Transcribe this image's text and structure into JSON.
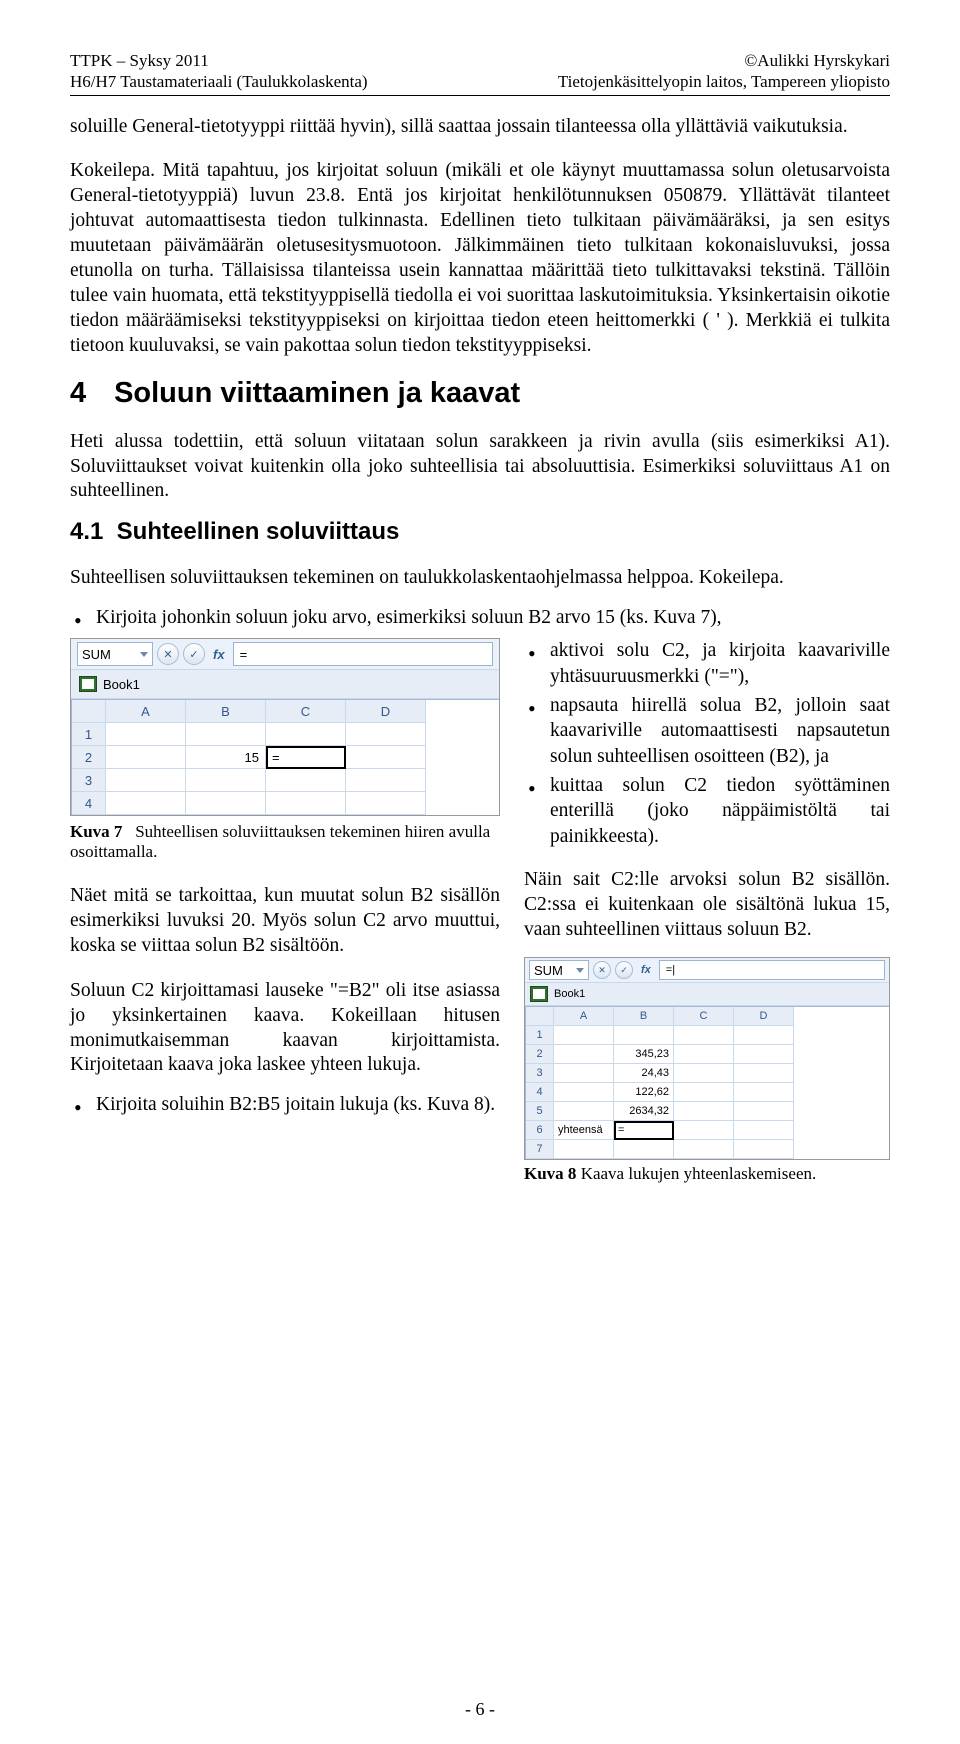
{
  "header": {
    "leftTop": "TTPK – Syksy 2011",
    "leftBottom": "H6/H7 Taustamateriaali (Taulukkolaskenta)",
    "rightTop": "©Aulikki Hyrskykari",
    "rightBottom": "Tietojenkäsittelyopin laitos, Tampereen yliopisto"
  },
  "para1": "soluille General-tietotyyppi riittää hyvin), sillä saattaa jossain tilanteessa olla yllättäviä vaikutuksia.",
  "para2": "Kokeilepa. Mitä tapahtuu, jos kirjoitat soluun (mikäli et ole käynyt muuttamassa solun oletusarvoista General-tietotyyppiä) luvun 23.8. Entä jos kirjoitat henkilötunnuksen 050879. Yllättävät tilanteet johtuvat automaattisesta tiedon tulkinnasta. Edellinen tieto tulkitaan päivämääräksi, ja sen esitys muutetaan päivämäärän oletusesitysmuotoon. Jälkimmäinen tieto tulkitaan kokonaisluvuksi, jossa etunolla on turha. Tällaisissa tilanteissa usein kannattaa määrittää tieto tulkittavaksi tekstinä. Tällöin tulee vain huomata, että tekstityyppisellä tiedolla ei voi suorittaa laskutoimituksia. Yksinkertaisin oikotie tiedon määräämiseksi tekstityyppiseksi on kirjoittaa tiedon eteen heittomerkki ( ' ). Merkkiä ei tulkita tietoon kuuluvaksi, se vain pakottaa solun tiedon tekstityyppiseksi.",
  "sec4": {
    "num": "4",
    "title": "Soluun viittaaminen ja kaavat"
  },
  "para3": "Heti alussa todettiin, että soluun viitataan solun sarakkeen ja rivin avulla (siis esimerkiksi A1). Soluviittaukset voivat kuitenkin olla joko suhteellisia tai absoluuttisia. Esimerkiksi soluviittaus A1 on suhteellinen.",
  "sub41": {
    "num": "4.1",
    "title": "Suhteellinen soluviittaus"
  },
  "para4": "Suhteellisen soluviittauksen tekeminen on taulukkolaskentaohjelmassa helppoa. Kokeilepa.",
  "bullet1": "Kirjoita johonkin soluun joku arvo, esimerkiksi soluun B2 arvo 15 (ks. Kuva 7),",
  "right": {
    "b1": "aktivoi solu C2, ja kirjoita kaavariville yhtäsuuruusmerkki (\"=\"),",
    "b2": "napsauta hiirellä solua B2, jolloin saat kaavariville automaattisesti napsautetun solun suhteellisen osoitteen (B2), ja",
    "b3": "kuittaa solun C2 tiedon syöttäminen enterillä (joko näppäimistöltä tai painikkeesta).",
    "p": "Näin sait C2:lle arvoksi solun B2 sisällön. C2:ssa ei kuitenkaan ole sisältönä lukua 15, vaan suhteellinen viittaus soluun B2."
  },
  "excel7": {
    "name": "SUM",
    "fx": "=",
    "book": "Book1",
    "cols": [
      "A",
      "B",
      "C",
      "D"
    ],
    "rows": [
      "1",
      "2",
      "3",
      "4"
    ],
    "b2": "15",
    "c2": "="
  },
  "cap7": {
    "num": "Kuva 7",
    "text": "Suhteellisen soluviittauksen tekeminen hiiren avulla osoittamalla."
  },
  "left": {
    "p1": "Näet mitä se tarkoittaa, kun muutat solun B2 sisällön esimerkiksi luvuksi 20. Myös solun C2 arvo muuttui, koska se viittaa solun B2 sisältöön.",
    "p2": "Soluun C2 kirjoittamasi lauseke \"=B2\" oli itse asiassa jo yksinkertainen kaava. Kokeillaan hitusen monimutkaisemman kaavan kirjoittamista. Kirjoitetaan kaava joka laskee yhteen lukuja.",
    "b": "Kirjoita soluihin B2:B5 joitain lukuja (ks. Kuva 8)."
  },
  "excel8": {
    "name": "SUM",
    "fx": "=|",
    "book": "Book1",
    "cols": [
      "A",
      "B",
      "C",
      "D"
    ],
    "rows": [
      "1",
      "2",
      "3",
      "4",
      "5",
      "6",
      "7"
    ],
    "b2": "345,23",
    "b3": "24,43",
    "b4": "122,62",
    "b5": "2634,32",
    "a6": "yhteensä",
    "b6": "="
  },
  "cap8": {
    "num": "Kuva 8",
    "text": "Kaava lukujen yhteenlaskemiseen."
  },
  "pagenum": "- 6 -"
}
